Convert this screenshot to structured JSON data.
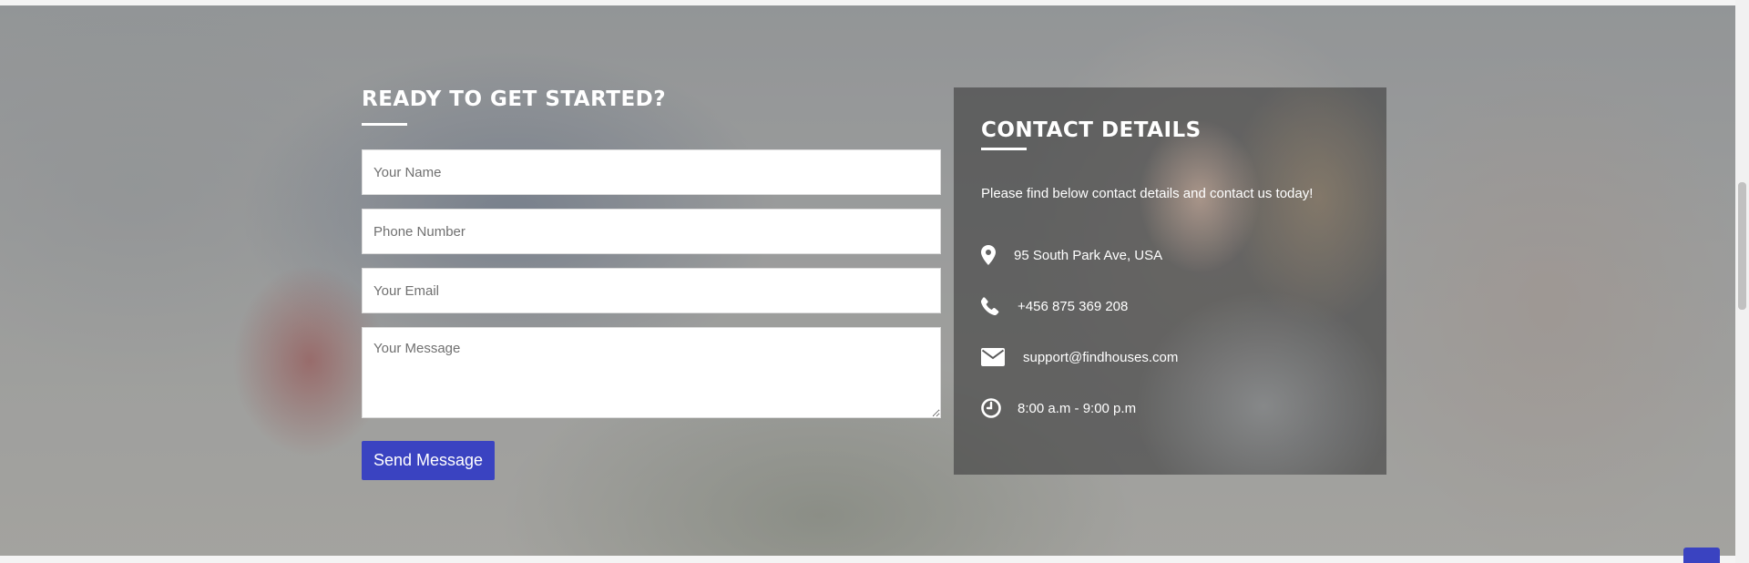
{
  "form": {
    "title": "READY TO GET STARTED?",
    "name_placeholder": "Your Name",
    "phone_placeholder": "Phone Number",
    "email_placeholder": "Your Email",
    "message_placeholder": "Your Message",
    "submit_label": "Send Message"
  },
  "contact": {
    "title": "CONTACT DETAILS",
    "intro": "Please find below contact details and contact us today!",
    "items": [
      {
        "icon": "map-marker-icon",
        "text": "95 South Park Ave, USA"
      },
      {
        "icon": "phone-icon",
        "text": "+456 875 369 208"
      },
      {
        "icon": "envelope-icon",
        "text": "support@findhouses.com"
      },
      {
        "icon": "clock-icon",
        "text": "8:00 a.m - 9:00 p.m"
      }
    ]
  },
  "colors": {
    "accent": "#3a43c1",
    "card_overlay": "#464646"
  }
}
